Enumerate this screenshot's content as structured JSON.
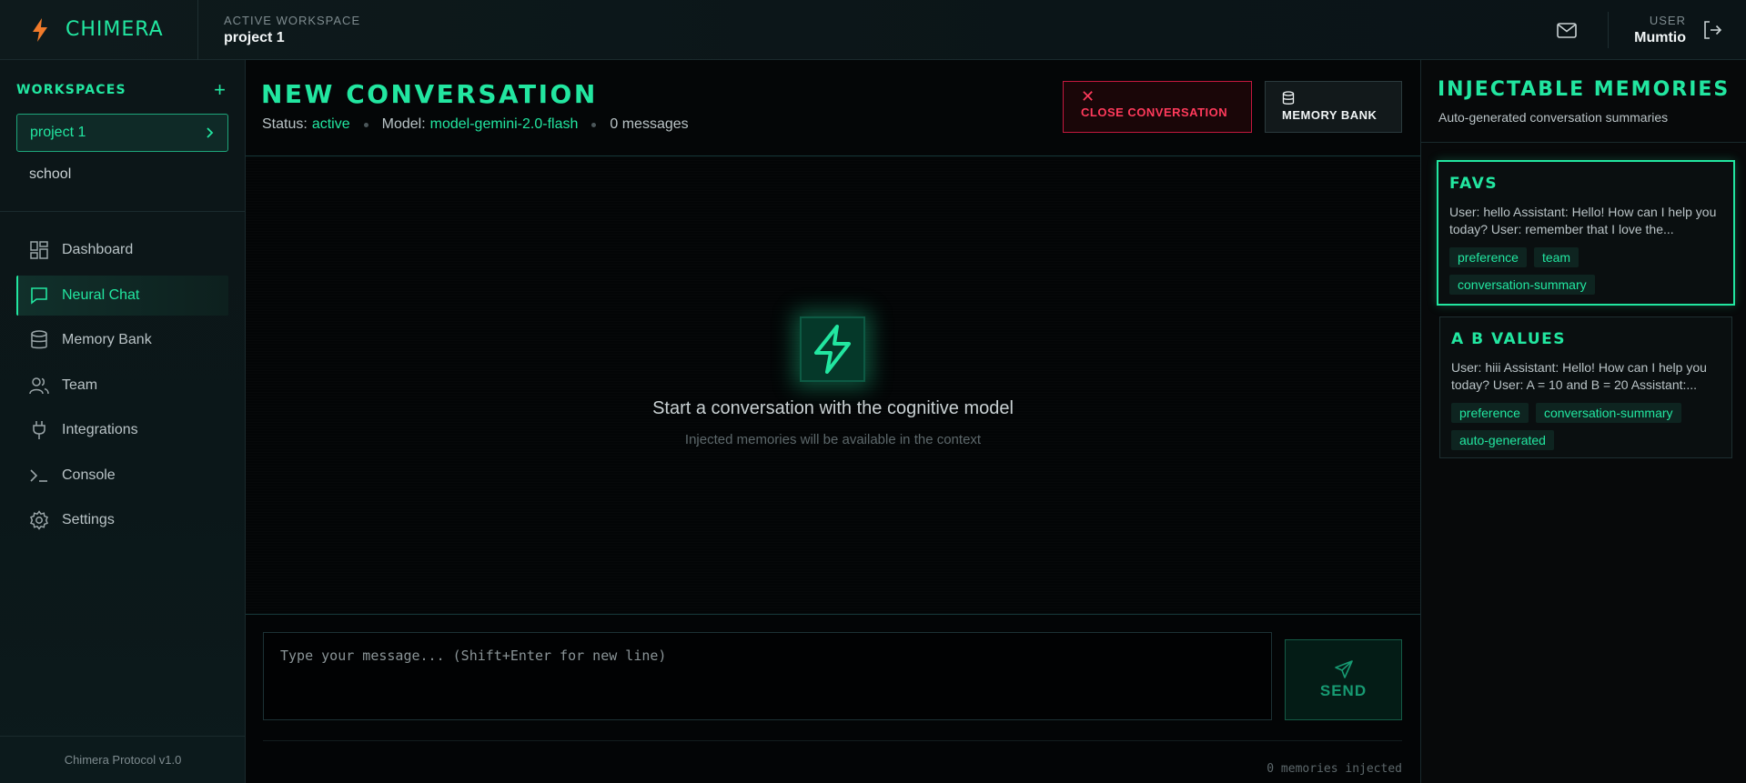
{
  "topbar": {
    "brand": "CHIMERA",
    "workspace_label": "ACTIVE WORKSPACE",
    "workspace_name": "project 1",
    "user_label": "USER",
    "user_name": "Mumtio"
  },
  "sidebar": {
    "workspaces_title": "WORKSPACES",
    "add_label": "+",
    "workspaces": [
      "project 1",
      "school"
    ],
    "nav": [
      {
        "label": "Dashboard",
        "icon": "dashboard-icon"
      },
      {
        "label": "Neural Chat",
        "icon": "chat-icon"
      },
      {
        "label": "Memory Bank",
        "icon": "database-icon"
      },
      {
        "label": "Team",
        "icon": "users-icon"
      },
      {
        "label": "Integrations",
        "icon": "plug-icon"
      },
      {
        "label": "Console",
        "icon": "terminal-icon"
      },
      {
        "label": "Settings",
        "icon": "gear-icon"
      }
    ],
    "footer": "Chimera Protocol v1.0"
  },
  "conversation": {
    "title": "NEW CONVERSATION",
    "status_label": "Status:",
    "status_value": "active",
    "model_label": "Model:",
    "model_value": "model-gemini-2.0-flash",
    "message_count": "0 messages",
    "close_label": "CLOSE CONVERSATION",
    "memory_bank_label": "MEMORY BANK",
    "empty_title": "Start a conversation with the cognitive model",
    "empty_subtitle": "Injected memories will be available in the context",
    "input_placeholder": "Type your message... (Shift+Enter for new line)",
    "send_label": "SEND",
    "memories_injected": "0 memories injected"
  },
  "memories": {
    "title": "INJECTABLE MEMORIES",
    "subtitle": "Auto-generated conversation summaries",
    "cards": [
      {
        "title": "FAVS",
        "text": "User: hello Assistant: Hello! How can I help you today? User: remember that I love the...",
        "tags": [
          "preference",
          "team",
          "conversation-summary"
        ]
      },
      {
        "title": "A B VALUES",
        "text": "User: hiii Assistant: Hello! How can I help you today? User: A = 10 and B = 20 Assistant:...",
        "tags": [
          "preference",
          "conversation-summary",
          "auto-generated"
        ]
      }
    ]
  },
  "colors": {
    "accent": "#22e6a0",
    "danger": "#ff3a5b",
    "background": "#050708"
  }
}
